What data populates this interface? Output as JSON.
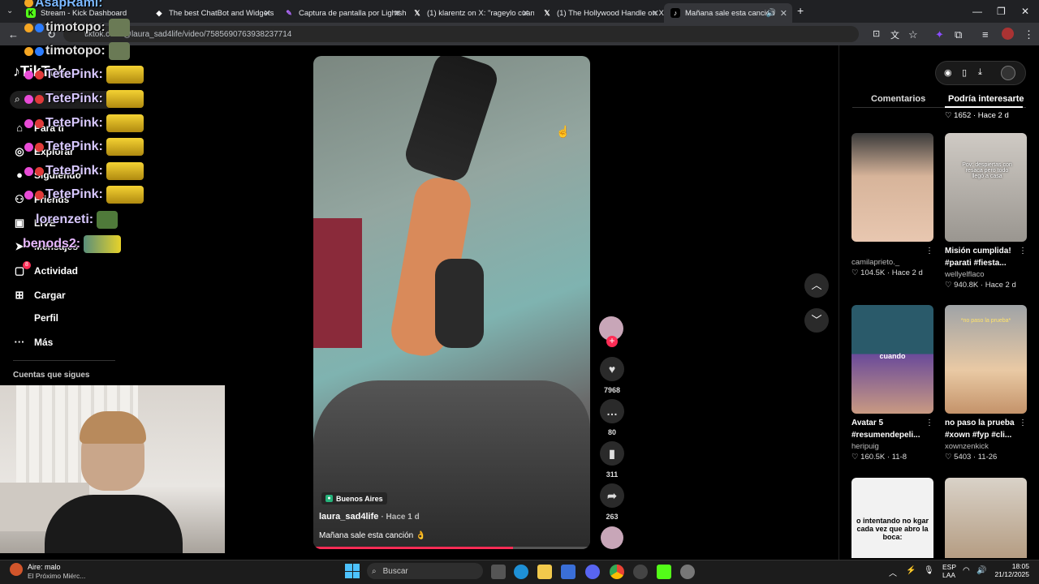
{
  "browser": {
    "tabs": [
      {
        "label": "Stream - Kick Dashboard"
      },
      {
        "label": "The best ChatBot and Widgets"
      },
      {
        "label": "Captura de pantalla por Lightsh"
      },
      {
        "label": "(1) klarentz on X: \"rageylo cuan"
      },
      {
        "label": "(1) The Hollywood Handle on X"
      },
      {
        "label": "Mañana sale esta canción"
      }
    ],
    "url": "tiktok.com/@laura_sad4life/video/7585690763938237714"
  },
  "sidebar": {
    "logo": "TikTok",
    "items": [
      {
        "label": "Para ti",
        "icon": "home-icon"
      },
      {
        "label": "Explorar",
        "icon": "compass-icon"
      },
      {
        "label": "Siguiendo",
        "icon": "avatar-icon"
      },
      {
        "label": "Friends",
        "icon": "friends-icon"
      },
      {
        "label": "LIVE",
        "icon": "live-icon"
      },
      {
        "label": "Mensajes",
        "icon": "message-icon"
      },
      {
        "label": "Actividad",
        "icon": "activity-icon"
      },
      {
        "label": "Cargar",
        "icon": "upload-icon"
      },
      {
        "label": "Perfil",
        "icon": "profile-icon"
      },
      {
        "label": "Más",
        "icon": "more-icon"
      }
    ],
    "following_header": "Cuentas que sigues",
    "activity_badge": "8"
  },
  "chat": [
    {
      "user": "AsapRaml:"
    },
    {
      "user": "timotopo:"
    },
    {
      "user": "timotopo:"
    },
    {
      "user": "TetePink:"
    },
    {
      "user": "TetePink:"
    },
    {
      "user": "TetePink:"
    },
    {
      "user": "TetePink:"
    },
    {
      "user": "TetePink:"
    },
    {
      "user": "TetePink:"
    },
    {
      "user": "lorenzeti:"
    },
    {
      "user": "benods2:"
    }
  ],
  "video": {
    "location": "Buenos Aires",
    "author": "laura_sad4life",
    "time": "· Hace 1 d",
    "caption": "Mañana sale esta canción 👌"
  },
  "actions": {
    "likes": "7968",
    "comments": "80",
    "saves": "311",
    "shares": "263"
  },
  "panel": {
    "tabs": [
      "Comentarios",
      "Podría interesarte"
    ],
    "top_meta": "♡ 1652 · Hace 2 d",
    "cards": [
      {
        "title": "",
        "author": "camilaprieto._",
        "meta": "♡ 104.5K · Hace 2 d",
        "overlay": ""
      },
      {
        "title": "Misión cumplida! #parati #fiesta...",
        "author": "wellyelflaco",
        "meta": "♡ 940.8K · Hace 2 d",
        "overlay": "Pov: despiertas con resaca pero todo llegó a casa"
      },
      {
        "title": "Avatar 5 #resumendepeli...",
        "author": "heripuig",
        "meta": "♡ 160.5K · 11-8",
        "overlay": "cuando"
      },
      {
        "title": "no paso la prueba #xown #fyp #cli...",
        "author": "xownzenkick",
        "meta": "♡ 5403 · 11-26",
        "overlay": "*no paso la prueba*"
      },
      {
        "title": "",
        "author": "",
        "meta": "",
        "overlay": "o intentando no kgar cada vez que abro la boca:"
      },
      {
        "title": "",
        "author": "",
        "meta": "",
        "overlay": ""
      }
    ]
  },
  "taskbar": {
    "weather_title": "Aire: malo",
    "weather_sub": "El Próximo Miérc...",
    "search_placeholder": "Buscar",
    "lang1": "ESP",
    "lang2": "LAA",
    "time": "18:05",
    "date": "21/12/2025"
  }
}
